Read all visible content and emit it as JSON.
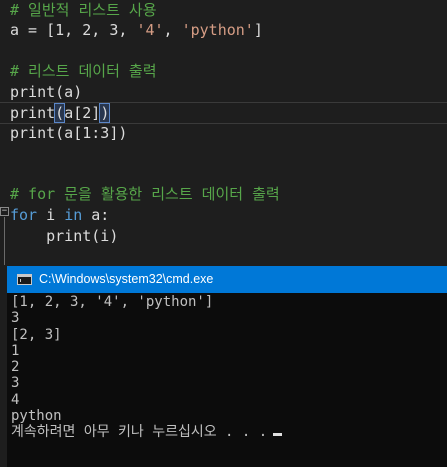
{
  "editor": {
    "lines": {
      "l1_comment": "# 일반적 리스트 사용",
      "l2_a": "a = [1, 2, 3, ",
      "l2_s1": "'4'",
      "l2_comma": ", ",
      "l2_s2": "'python'",
      "l2_end": "]",
      "l4_comment": "# 리스트 데이터 출력",
      "l5": "print(a)",
      "l6_pre": "print",
      "l6_open": "(",
      "l6_mid": "a[2]",
      "l6_close": ")",
      "l7": "print(a[1:3])",
      "l10_comment": "# for 문을 활용한 리스트 데이터 출력",
      "l11_for": "for",
      "l11_i": " i ",
      "l11_in": "in",
      "l11_a": " a:",
      "l12": "    print(i)"
    },
    "fold_symbol": "−"
  },
  "cmd": {
    "title": "C:\\Windows\\system32\\cmd.exe",
    "icon": "cmd-window-icon",
    "output": [
      "[1, 2, 3, '4', 'python']",
      "3",
      "[2, 3]",
      "1",
      "2",
      "3",
      "4",
      "python"
    ],
    "prompt": "계속하려면 아무 키나 누르십시오 . . ."
  },
  "colors": {
    "comment": "#57a64a",
    "keyword": "#569cd6",
    "string": "#d69d85",
    "titlebar": "#0078d7",
    "console_bg": "#0c0c0c"
  }
}
